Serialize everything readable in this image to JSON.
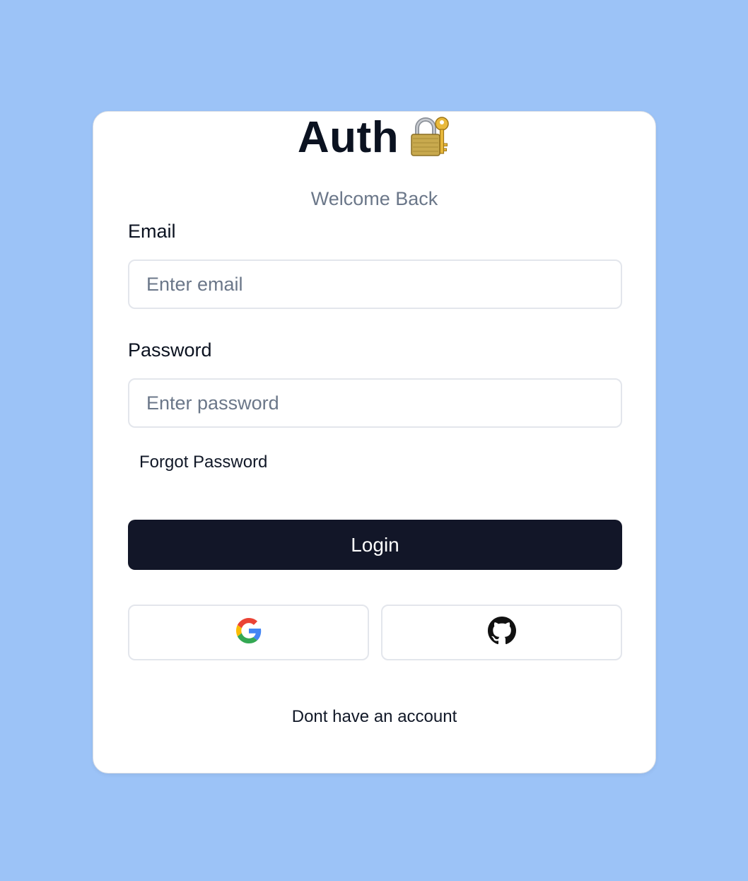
{
  "app": {
    "title": "Auth",
    "title_emoji": "lock-with-key-icon",
    "subtitle": "Welcome Back"
  },
  "form": {
    "email_label": "Email",
    "email_placeholder": "Enter email",
    "email_value": "",
    "password_label": "Password",
    "password_placeholder": "Enter password",
    "password_value": "",
    "forgot_label": "Forgot Password",
    "login_label": "Login"
  },
  "oauth": {
    "providers": [
      "google-icon",
      "github-icon"
    ]
  },
  "footer": {
    "signup_label": "Dont have an account"
  },
  "colors": {
    "background": "#9cc3f7",
    "card": "#ffffff",
    "primary_button": "#121628",
    "muted_text": "#6b7789"
  }
}
